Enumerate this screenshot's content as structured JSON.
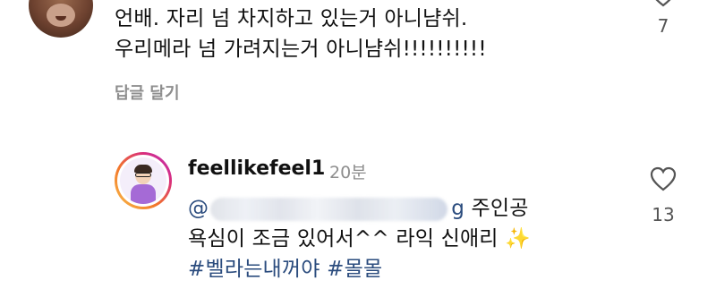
{
  "comment1": {
    "line1": "언배. 자리 넘 차지하고 있는거 아니냠쉬.",
    "line2": "우리메라 넘 가려지는거 아니냠쉬!!!!!!!!!!",
    "reply_label": "답글 달기",
    "like_count": "7",
    "like_icon": "heart-icon"
  },
  "comment2": {
    "username": "feellikefeel1",
    "timestamp": "20분",
    "mention_prefix": "@",
    "mention_tail": "g",
    "line1_tail": "주인공",
    "line2": "욕심이 조금 있어서^^ 라익 신애리",
    "sparkle": "✨",
    "hashtags": [
      "#벨라는내꺼야",
      "#몰몰"
    ],
    "like_count": "13",
    "like_icon": "heart-icon"
  },
  "colors": {
    "text": "#111111",
    "secondary": "#8e8e8e",
    "link": "#2b4c7e"
  }
}
